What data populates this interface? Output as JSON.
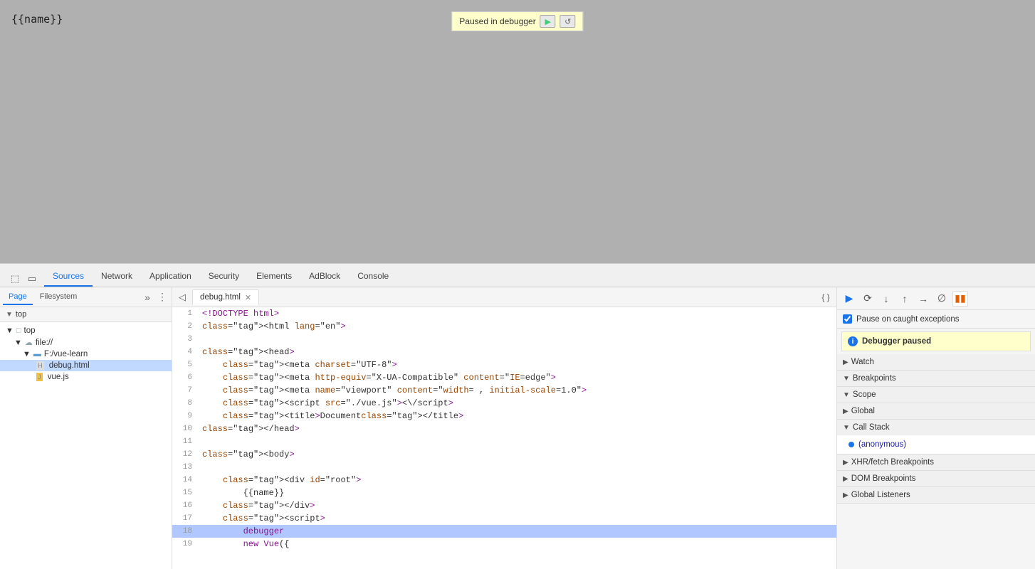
{
  "preview": {
    "template_text": "{{name}}"
  },
  "debugger_banner": {
    "text": "Paused in debugger",
    "resume_label": "▶",
    "stepover_label": "↺"
  },
  "tabs": {
    "items": [
      {
        "label": "Sources",
        "active": true
      },
      {
        "label": "Network",
        "active": false
      },
      {
        "label": "Application",
        "active": false
      },
      {
        "label": "Security",
        "active": false
      },
      {
        "label": "Elements",
        "active": false
      },
      {
        "label": "AdBlock",
        "active": false
      },
      {
        "label": "Console",
        "active": false
      }
    ]
  },
  "left_panel": {
    "tabs": [
      {
        "label": "Page",
        "active": true
      },
      {
        "label": "Filesystem",
        "active": false
      }
    ],
    "tree": [
      {
        "indent": 1,
        "type": "folder",
        "label": "top",
        "expanded": true
      },
      {
        "indent": 2,
        "type": "cloud",
        "label": "file://",
        "expanded": true
      },
      {
        "indent": 3,
        "type": "folder-blue",
        "label": "F:/vue-learn",
        "expanded": true
      },
      {
        "indent": 4,
        "type": "file-html",
        "label": "debug.html",
        "selected": true
      },
      {
        "indent": 4,
        "type": "file-js",
        "label": "vue.js",
        "selected": false
      }
    ]
  },
  "top_frame": {
    "label": "top"
  },
  "editor": {
    "filename": "debug.html",
    "lines": [
      {
        "num": 1,
        "code": "<!DOCTYPE html>",
        "type": "doctype"
      },
      {
        "num": 2,
        "code": "<html lang=\"en\">",
        "type": "html"
      },
      {
        "num": 3,
        "code": "",
        "type": "plain"
      },
      {
        "num": 4,
        "code": "<head>",
        "type": "html"
      },
      {
        "num": 5,
        "code": "    <meta charset=\"UTF-8\">",
        "type": "html"
      },
      {
        "num": 6,
        "code": "    <meta http-equiv=\"X-UA-Compatible\" content=\"IE=edge\">",
        "type": "html"
      },
      {
        "num": 7,
        "code": "    <meta name=\"viewport\" content=\"width= , initial-scale=1.0\">",
        "type": "html"
      },
      {
        "num": 8,
        "code": "    <script src=\"./vue.js\"><\\/script>",
        "type": "html"
      },
      {
        "num": 9,
        "code": "    <title>Document</title>",
        "type": "html"
      },
      {
        "num": 10,
        "code": "</head>",
        "type": "html"
      },
      {
        "num": 11,
        "code": "",
        "type": "plain"
      },
      {
        "num": 12,
        "code": "<body>",
        "type": "html"
      },
      {
        "num": 13,
        "code": "",
        "type": "plain"
      },
      {
        "num": 14,
        "code": "    <div id=\"root\">",
        "type": "html"
      },
      {
        "num": 15,
        "code": "        {{name}}",
        "type": "plain"
      },
      {
        "num": 16,
        "code": "    </div>",
        "type": "html"
      },
      {
        "num": 17,
        "code": "    <script>",
        "type": "html"
      },
      {
        "num": 18,
        "code": "        debugger",
        "type": "debugger",
        "highlighted": true
      },
      {
        "num": 19,
        "code": "        new Vue({",
        "type": "js"
      }
    ]
  },
  "right_panel": {
    "debug_buttons": [
      {
        "label": "▶",
        "name": "resume",
        "active": false
      },
      {
        "label": "⟳",
        "name": "step-over"
      },
      {
        "label": "↓",
        "name": "step-into"
      },
      {
        "label": "↑",
        "name": "step-out"
      },
      {
        "label": "→",
        "name": "step"
      },
      {
        "label": "∅",
        "name": "deactivate"
      },
      {
        "label": "⏸",
        "name": "pause",
        "paused": true
      }
    ],
    "pause_exceptions": {
      "label": "Pause on caught exceptions",
      "checked": true
    },
    "debugger_paused": {
      "text": "Debugger paused"
    },
    "sections": [
      {
        "id": "watch",
        "label": "Watch",
        "expanded": false,
        "arrow": "▶"
      },
      {
        "id": "breakpoints",
        "label": "Breakpoints",
        "expanded": false,
        "arrow": "▼"
      },
      {
        "id": "scope",
        "label": "Scope",
        "expanded": true,
        "arrow": "▼"
      },
      {
        "id": "global",
        "label": "Global",
        "expanded": false,
        "arrow": "▶"
      },
      {
        "id": "call-stack",
        "label": "Call Stack",
        "expanded": true,
        "arrow": "▼"
      },
      {
        "id": "xhr-breakpoints",
        "label": "XHR/fetch Breakpoints",
        "expanded": false,
        "arrow": "▶"
      },
      {
        "id": "dom-breakpoints",
        "label": "DOM Breakpoints",
        "expanded": false,
        "arrow": "▶"
      },
      {
        "id": "global-listeners",
        "label": "Global Listeners",
        "expanded": false,
        "arrow": "▶"
      }
    ],
    "call_stack": {
      "items": [
        {
          "label": "(anonymous)"
        }
      ]
    }
  }
}
